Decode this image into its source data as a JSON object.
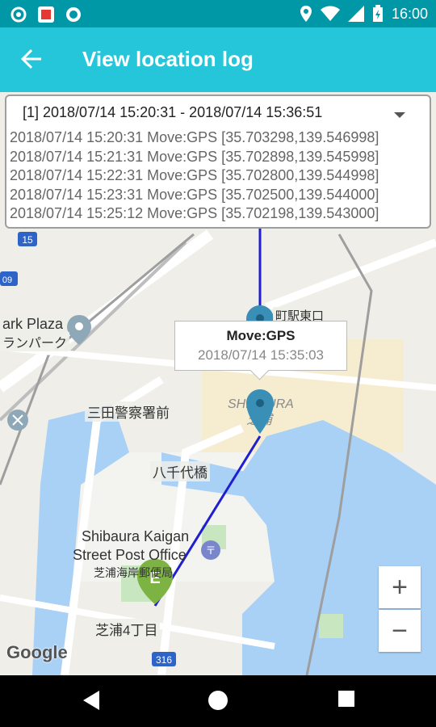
{
  "status_bar": {
    "time": "16:00",
    "icons": [
      "settings-icon",
      "app-notification-icon",
      "record-icon",
      "location-icon",
      "wifi-icon",
      "signal-icon",
      "battery-charging-icon"
    ]
  },
  "app_bar": {
    "title": "View location log",
    "back_icon": "arrow-back-icon"
  },
  "log_card": {
    "selected_range": "[1] 2018/07/14 15:20:31 - 2018/07/14 15:36:51",
    "entries": [
      "2018/07/14 15:20:31 Move:GPS [35.703298,139.546998]",
      "2018/07/14 15:21:31 Move:GPS [35.702898,139.545998]",
      "2018/07/14 15:22:31 Move:GPS [35.702800,139.544998]",
      "2018/07/14 15:23:31 Move:GPS [35.702500,139.544000]",
      "2018/07/14 15:25:12 Move:GPS [35.702198,139.543000]"
    ]
  },
  "info_window": {
    "title": "Move:GPS",
    "time": "2018/07/14 15:35:03"
  },
  "map": {
    "labels": {
      "park": "ark Plaza",
      "park_jp": "ランパーク",
      "police": "三田警察署前",
      "yachiyo": "八千代橋",
      "post1": "Shibaura Kaigan",
      "post2": "Street Post Office",
      "post_jp": "芝浦海岸郵便局",
      "shibaura4": "芝浦4丁目",
      "area": "SHIBAURA",
      "area_jp": "芝浦",
      "station": "町駅東口",
      "route15": "15",
      "route316": "316",
      "route409": "09"
    },
    "end_marker_letter": "E",
    "route_color": "#1f1fcf",
    "zoom_in": "+",
    "zoom_out": "−",
    "attribution": "Google"
  },
  "nav_bar": {
    "buttons": [
      "back-nav-icon",
      "home-nav-icon",
      "recents-nav-icon"
    ]
  }
}
